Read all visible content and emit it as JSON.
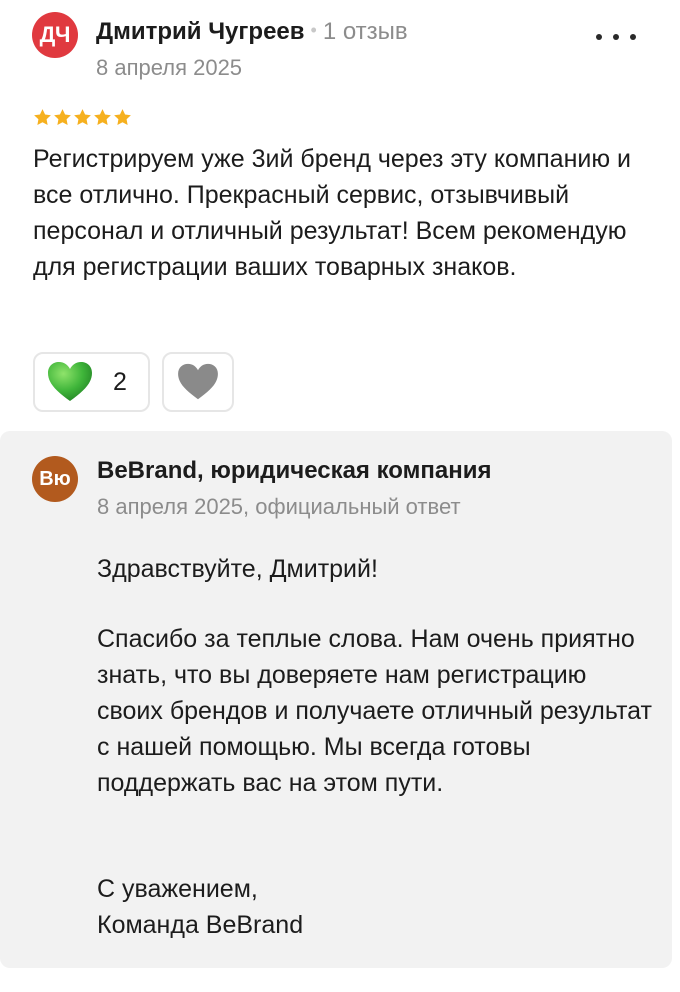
{
  "review": {
    "avatar_initials": "ДЧ",
    "author": "Дмитрий Чугреев",
    "review_count": "1 отзыв",
    "date": "8 апреля 2025",
    "rating": 5,
    "text": "Регистрируем уже 3ий бренд через эту компанию и все отлично. Прекрасный сервис, отзывчивый персонал и отличный результат! Всем рекомендую для регистрации ваших товарных знаков.",
    "likes": "2"
  },
  "answer": {
    "avatar_initials": "Вю",
    "company": "BeBrand, юридическая компания",
    "meta": "8 апреля 2025, официальный ответ",
    "greeting": "Здравствуйте, Дмитрий!",
    "body": "Спасибо за теплые слова. Нам очень приятно знать, что вы доверяете нам регистрацию своих брендов и получаете отличный результат с нашей помощью. Мы всегда готовы поддержать вас на этом пути.",
    "closing_1": "С уважением,",
    "closing_2": "Команда BeBrand"
  },
  "colors": {
    "user_avatar": "#e0393f",
    "company_avatar": "#b25a1e",
    "star": "#f6b01e",
    "like_heart": "#3fb53a",
    "dislike_heart": "#8a8a8a",
    "answer_bg": "#f2f2f2"
  },
  "icons": {
    "more": "more-dots-icon",
    "star": "star-icon",
    "like": "green-heart-icon",
    "dislike": "grey-heart-icon"
  }
}
